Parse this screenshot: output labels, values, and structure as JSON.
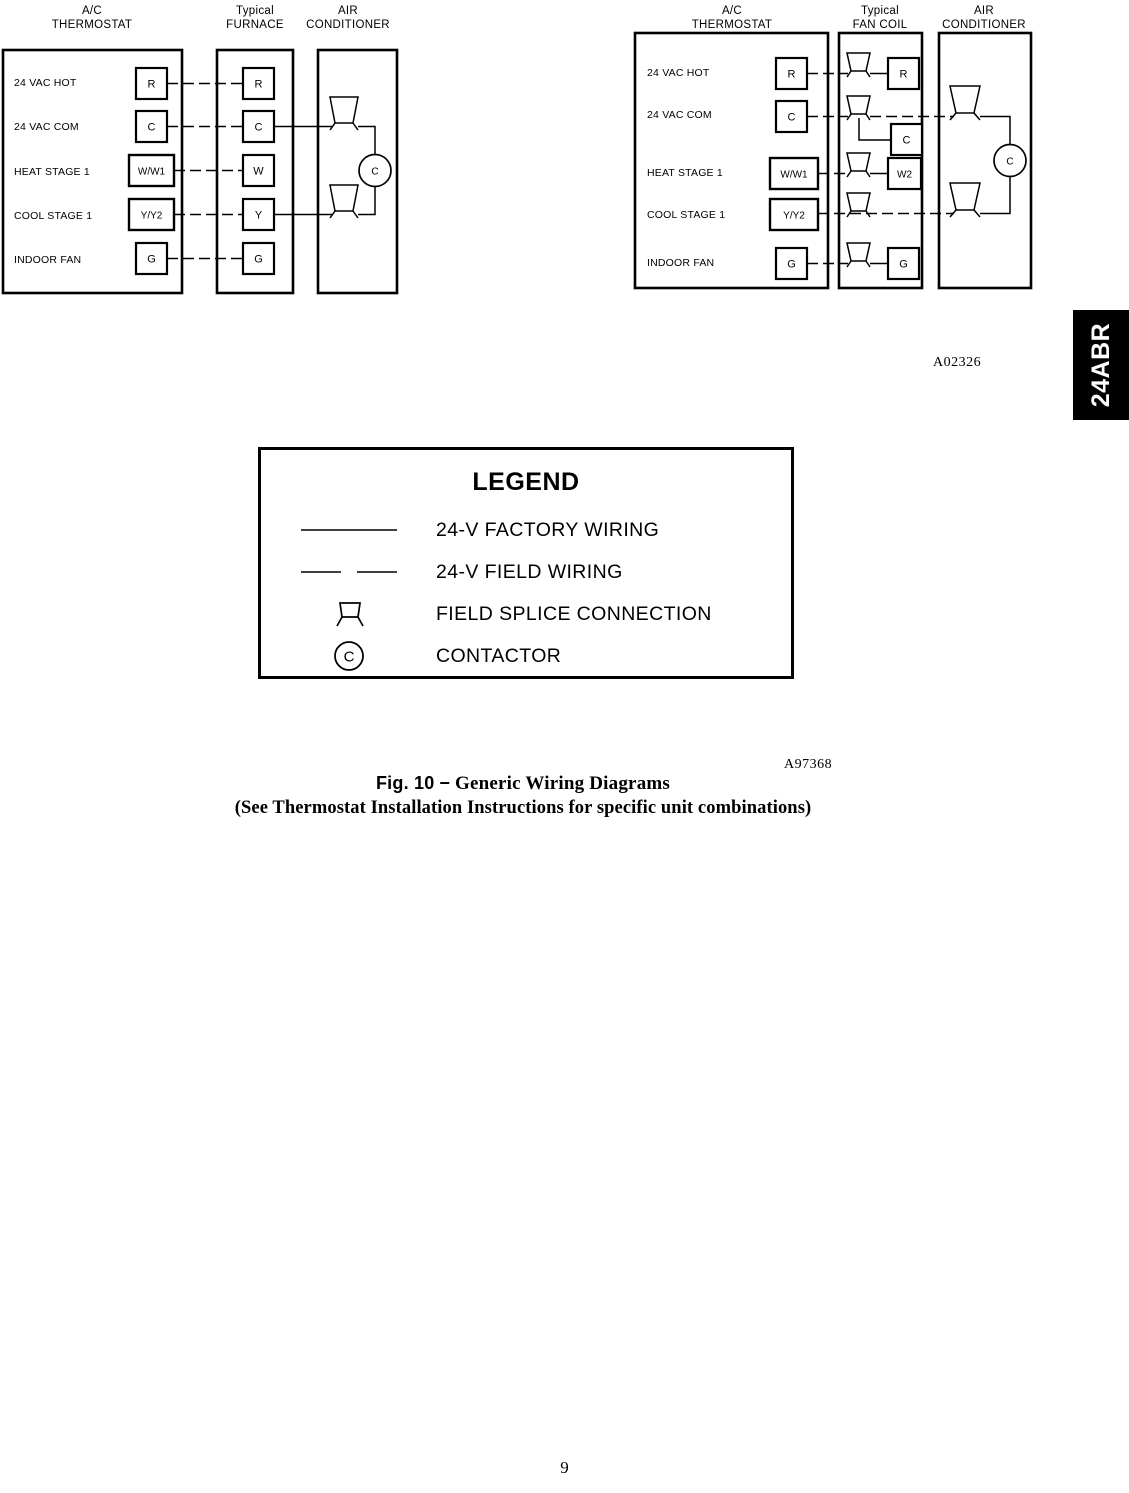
{
  "page": {
    "page_number": "9",
    "side_tab_label": "24ABR"
  },
  "diagram_left": {
    "ref_code": "A97368",
    "units": [
      {
        "title_line1": "A/C",
        "title_line2": "THERMOSTAT"
      },
      {
        "title_line1": "Typical",
        "title_line2": "FURNACE"
      },
      {
        "title_line1": "AIR",
        "title_line2": "CONDITIONER"
      }
    ],
    "rows": [
      {
        "label": "24 VAC HOT",
        "thermostat_terminal": "R",
        "equipment_terminal": "R"
      },
      {
        "label": "24 VAC COM",
        "thermostat_terminal": "C",
        "equipment_terminal": "C"
      },
      {
        "label": "HEAT STAGE 1",
        "thermostat_terminal": "W/W1",
        "equipment_terminal": "W"
      },
      {
        "label": "COOL STAGE 1",
        "thermostat_terminal": "Y/Y2",
        "equipment_terminal": "Y"
      },
      {
        "label": "INDOOR FAN",
        "thermostat_terminal": "G",
        "equipment_terminal": "G"
      }
    ],
    "contactor_label": "C"
  },
  "diagram_right": {
    "ref_code": "A02326",
    "units": [
      {
        "title_line1": "A/C",
        "title_line2": "THERMOSTAT"
      },
      {
        "title_line1": "Typical",
        "title_line2": "FAN COIL"
      },
      {
        "title_line1": "AIR",
        "title_line2": "CONDITIONER"
      }
    ],
    "rows": [
      {
        "label": "24 VAC HOT",
        "thermostat_terminal": "R",
        "equipment_terminal": "R"
      },
      {
        "label": "24 VAC COM",
        "thermostat_terminal": "C",
        "equipment_terminal": "C"
      },
      {
        "label": "HEAT STAGE 1",
        "thermostat_terminal": "W/W1",
        "equipment_terminal": "W2"
      },
      {
        "label": "COOL STAGE 1",
        "thermostat_terminal": "Y/Y2",
        "equipment_terminal": ""
      },
      {
        "label": "INDOOR FAN",
        "thermostat_terminal": "G",
        "equipment_terminal": "G"
      }
    ],
    "contactor_label": "C"
  },
  "legend": {
    "title": "LEGEND",
    "items": [
      {
        "symbol": "solid-line",
        "label": "24-V FACTORY WIRING"
      },
      {
        "symbol": "dashed-line",
        "label": "24-V FIELD WIRING"
      },
      {
        "symbol": "splice-icon",
        "label": "FIELD SPLICE CONNECTION"
      },
      {
        "symbol": "contactor-icon",
        "label": "CONTACTOR",
        "glyph": "C"
      }
    ]
  },
  "caption": {
    "figure_number": "Fig. 10",
    "dash": "−",
    "title": "Generic Wiring Diagrams",
    "subtitle": "(See Thermostat Installation Instructions for specific unit combinations)"
  }
}
